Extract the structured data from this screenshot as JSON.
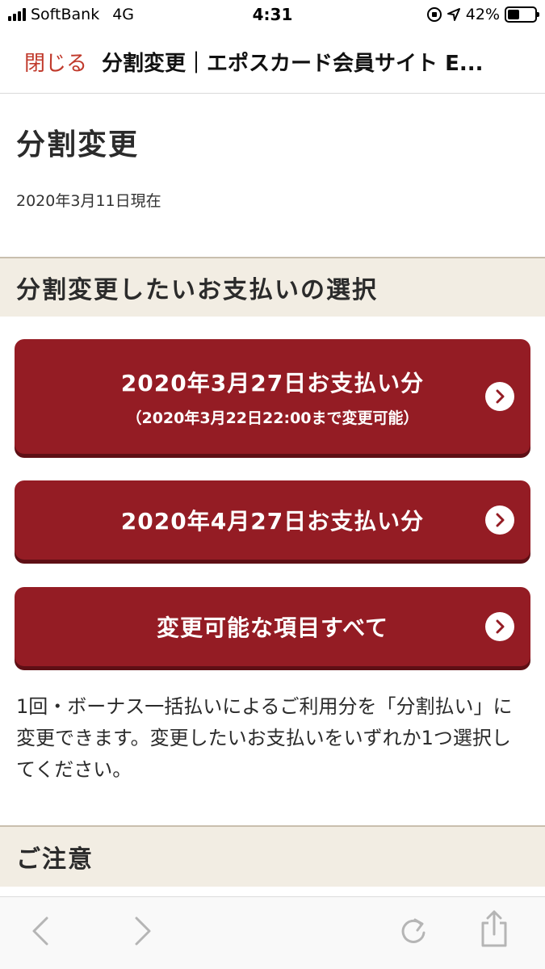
{
  "status_bar": {
    "carrier": "SoftBank",
    "network": "4G",
    "time": "4:31",
    "battery": "42%"
  },
  "nav": {
    "close_label": "閉じる",
    "page_title": "分割変更｜エポスカード会員サイト E..."
  },
  "page": {
    "title": "分割変更",
    "as_of": "2020年3月11日現在"
  },
  "select_section": {
    "heading": "分割変更したいお支払いの選択",
    "options": [
      {
        "label": "2020年3月27日お支払い分",
        "note": "（2020年3月22日22:00まで変更可能）"
      },
      {
        "label": "2020年4月27日お支払い分"
      },
      {
        "label": "変更可能な項目すべて"
      }
    ],
    "description": "1回・ボーナス一括払いによるご利用分を「分割払い」に変更できます。変更したいお支払いをいずれか1つ選択してください。"
  },
  "caution_section": {
    "heading": "ご注意"
  },
  "colors": {
    "button": "#941c24",
    "button_shadow": "#5e0f15",
    "close_link": "#c0392b",
    "section_band": "#f2ede3"
  },
  "icons": {
    "chevron": "chevron-right-icon",
    "back": "back-arrow-icon",
    "forward": "forward-arrow-icon",
    "reload": "reload-icon",
    "share": "share-icon"
  }
}
